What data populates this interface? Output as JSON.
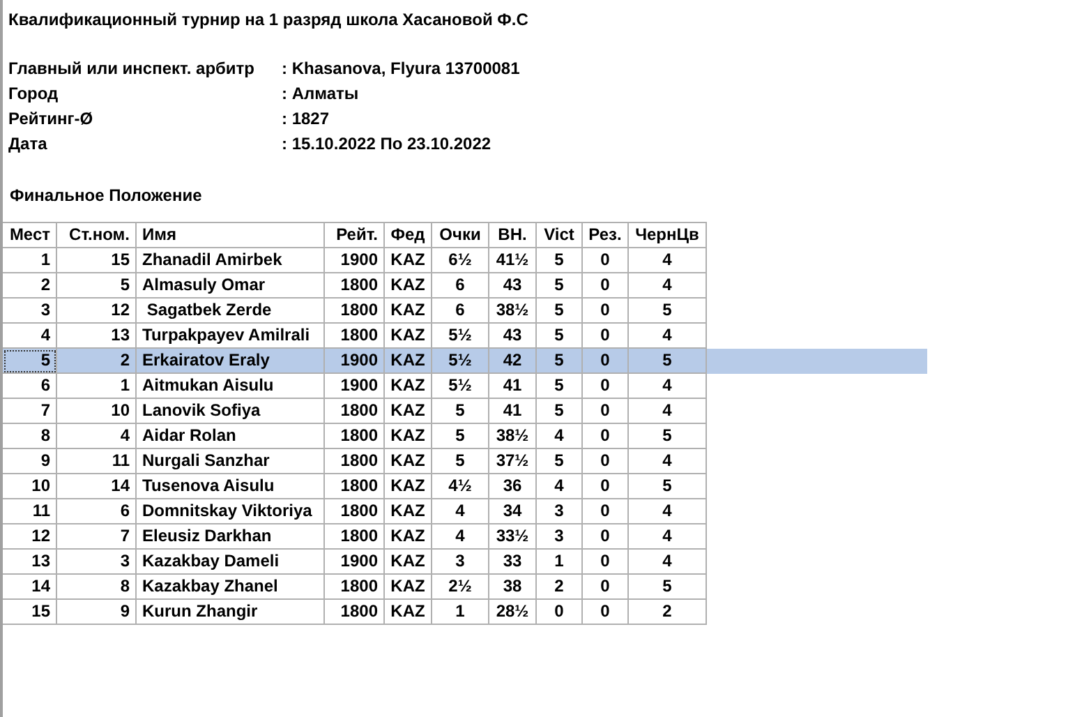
{
  "title": "Квалификационный турнир на 1 разряд школа Хасановой Ф.С",
  "info": [
    {
      "label": "Главный или инспект. арбитр",
      "value": ": Khasanova, Flyura 13700081"
    },
    {
      "label": "Город",
      "value": ": Алматы"
    },
    {
      "label": "Рейтинг-Ø",
      "value": ": 1827"
    },
    {
      "label": "Дата",
      "value": ": 15.10.2022 По 23.10.2022"
    }
  ],
  "section_title": "Финальное Положение",
  "table": {
    "columns": [
      "Мест",
      "Ст.ном.",
      "Имя",
      "Рейт.",
      "Фед",
      "Очки",
      "ВН.",
      "Vict",
      "Рез.",
      "ЧернЦв"
    ],
    "rows": [
      {
        "cells": [
          "1",
          "15",
          "Zhanadil Amirbek",
          "1900",
          "KAZ",
          "6½",
          "41½",
          "5",
          "0",
          "4"
        ],
        "selected": false
      },
      {
        "cells": [
          "2",
          "5",
          "Almasuly Omar",
          "1800",
          "KAZ",
          "6",
          "43",
          "5",
          "0",
          "4"
        ],
        "selected": false
      },
      {
        "cells": [
          "3",
          "12",
          " Sagatbek Zerde",
          "1800",
          "KAZ",
          "6",
          "38½",
          "5",
          "0",
          "5"
        ],
        "selected": false
      },
      {
        "cells": [
          "4",
          "13",
          "Turpakpayev Amilrali",
          "1800",
          "KAZ",
          "5½",
          "43",
          "5",
          "0",
          "4"
        ],
        "selected": false
      },
      {
        "cells": [
          "5",
          "2",
          "Erkairatov Eraly",
          "1900",
          "KAZ",
          "5½",
          "42",
          "5",
          "0",
          "5"
        ],
        "selected": true
      },
      {
        "cells": [
          "6",
          "1",
          "Aitmukan Aisulu",
          "1900",
          "KAZ",
          "5½",
          "41",
          "5",
          "0",
          "4"
        ],
        "selected": false
      },
      {
        "cells": [
          "7",
          "10",
          "Lanovik Sofiya",
          "1800",
          "KAZ",
          "5",
          "41",
          "5",
          "0",
          "4"
        ],
        "selected": false
      },
      {
        "cells": [
          "8",
          "4",
          "Aidar Rolan",
          "1800",
          "KAZ",
          "5",
          "38½",
          "4",
          "0",
          "5"
        ],
        "selected": false
      },
      {
        "cells": [
          "9",
          "11",
          "Nurgali Sanzhar",
          "1800",
          "KAZ",
          "5",
          "37½",
          "5",
          "0",
          "4"
        ],
        "selected": false
      },
      {
        "cells": [
          "10",
          "14",
          "Tusenova Aisulu",
          "1800",
          "KAZ",
          "4½",
          "36",
          "4",
          "0",
          "5"
        ],
        "selected": false
      },
      {
        "cells": [
          "11",
          "6",
          "Domnitskay Viktoriya",
          "1800",
          "KAZ",
          "4",
          "34",
          "3",
          "0",
          "4"
        ],
        "selected": false
      },
      {
        "cells": [
          "12",
          "7",
          "Eleusiz Darkhan",
          "1800",
          "KAZ",
          "4",
          "33½",
          "3",
          "0",
          "4"
        ],
        "selected": false
      },
      {
        "cells": [
          "13",
          "3",
          "Kazakbay Dameli",
          "1900",
          "KAZ",
          "3",
          "33",
          "1",
          "0",
          "4"
        ],
        "selected": false
      },
      {
        "cells": [
          "14",
          "8",
          "Kazakbay Zhanel",
          "1800",
          "KAZ",
          "2½",
          "38",
          "2",
          "0",
          "5"
        ],
        "selected": false
      },
      {
        "cells": [
          "15",
          "9",
          "Kurun Zhangir",
          "1800",
          "KAZ",
          "1",
          "28½",
          "0",
          "0",
          "2"
        ],
        "selected": false
      }
    ]
  }
}
